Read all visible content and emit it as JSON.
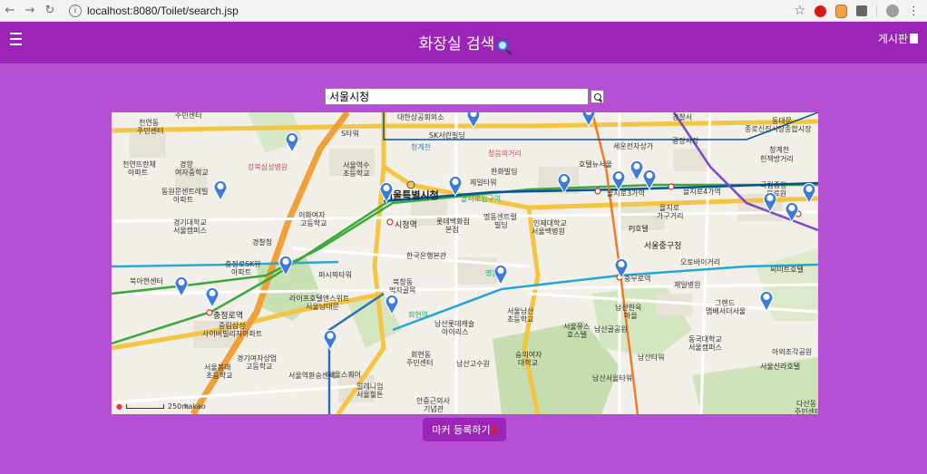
{
  "browser": {
    "url": "localhost:8080/Toilet/search.jsp"
  },
  "header": {
    "title": "화장실 검색",
    "board_link": "게시판"
  },
  "search": {
    "value": "서울시청"
  },
  "map": {
    "scale_label": "250m",
    "provider": "kakao",
    "labels": [
      {
        "text": "천연동",
        "cls": ""
      },
      {
        "text": "주민센터",
        "cls": ""
      },
      {
        "text": "주민센터",
        "cls": ""
      },
      {
        "text": "천연뜨란채",
        "cls": ""
      },
      {
        "text": "아파트",
        "cls": ""
      },
      {
        "text": "경향",
        "cls": ""
      },
      {
        "text": "여자중학교",
        "cls": ""
      },
      {
        "text": "강북삼성병원",
        "cls": ""
      },
      {
        "text": "동원문센트레빌",
        "cls": ""
      },
      {
        "text": "아파트",
        "cls": ""
      },
      {
        "text": "S타워",
        "cls": ""
      },
      {
        "text": "서울역수",
        "cls": ""
      },
      {
        "text": "초등학교",
        "cls": ""
      },
      {
        "text": "이화여자",
        "cls": ""
      },
      {
        "text": "고등학교",
        "cls": ""
      },
      {
        "text": "경기대학교",
        "cls": ""
      },
      {
        "text": "서울캠퍼스",
        "cls": ""
      },
      {
        "text": "경찰청",
        "cls": ""
      },
      {
        "text": "충정로SK뷰",
        "cls": ""
      },
      {
        "text": "아파트",
        "cls": ""
      },
      {
        "text": "북아현센터",
        "cls": ""
      },
      {
        "text": "충정로역",
        "cls": "mid"
      },
      {
        "text": "중림삼성",
        "cls": ""
      },
      {
        "text": "사이버빌리지아파트",
        "cls": ""
      },
      {
        "text": "경기여자상업",
        "cls": ""
      },
      {
        "text": "고등학교",
        "cls": ""
      },
      {
        "text": "서울봉래",
        "cls": ""
      },
      {
        "text": "초등학교",
        "cls": ""
      },
      {
        "text": "퍼시픽타워",
        "cls": ""
      },
      {
        "text": "라이프호텔앤스위트",
        "cls": ""
      },
      {
        "text": "서울남대문",
        "cls": ""
      },
      {
        "text": "서울역환승센터",
        "cls": ""
      },
      {
        "text": "서울스퀘어",
        "cls": ""
      },
      {
        "text": "밀레니엄",
        "cls": ""
      },
      {
        "text": "서울힐튼",
        "cls": ""
      },
      {
        "text": "SK서린빌딩",
        "cls": ""
      },
      {
        "text": "청계천",
        "cls": ""
      },
      {
        "text": "청음의거리",
        "cls": ""
      },
      {
        "text": "제일타워",
        "cls": ""
      },
      {
        "text": "한화빌딩",
        "cls": ""
      },
      {
        "text": "서울특별시청",
        "cls": "big"
      },
      {
        "text": "을지로입구역",
        "cls": ""
      },
      {
        "text": "시청역",
        "cls": "mid"
      },
      {
        "text": "롯데백화점",
        "cls": ""
      },
      {
        "text": "본점",
        "cls": ""
      },
      {
        "text": "명동센트럴",
        "cls": ""
      },
      {
        "text": "빌딩",
        "cls": ""
      },
      {
        "text": "인제대학교",
        "cls": ""
      },
      {
        "text": "서울백병원",
        "cls": ""
      },
      {
        "text": "한국은행본관",
        "cls": ""
      },
      {
        "text": "북창동",
        "cls": ""
      },
      {
        "text": "먹자골목",
        "cls": ""
      },
      {
        "text": "회현역",
        "cls": ""
      },
      {
        "text": "남산롯데캐슬",
        "cls": ""
      },
      {
        "text": "아이리스",
        "cls": ""
      },
      {
        "text": "회현동",
        "cls": ""
      },
      {
        "text": "주민센터",
        "cls": ""
      },
      {
        "text": "남산고수원",
        "cls": ""
      },
      {
        "text": "명동역",
        "cls": ""
      },
      {
        "text": "서울남산",
        "cls": ""
      },
      {
        "text": "초등학교",
        "cls": ""
      },
      {
        "text": "숭의여자",
        "cls": ""
      },
      {
        "text": "대학교",
        "cls": ""
      },
      {
        "text": "안중근의사",
        "cls": ""
      },
      {
        "text": "기념관",
        "cls": ""
      },
      {
        "text": "세운전자상가",
        "cls": ""
      },
      {
        "text": "호텔뉴서울",
        "cls": ""
      },
      {
        "text": "을지로3가역",
        "cls": ""
      },
      {
        "text": "PJ호텔",
        "cls": ""
      },
      {
        "text": "서울중구청",
        "cls": "mid"
      },
      {
        "text": "충무로역",
        "cls": ""
      },
      {
        "text": "서울유스",
        "cls": ""
      },
      {
        "text": "호스텔",
        "cls": ""
      },
      {
        "text": "남산골공원",
        "cls": ""
      },
      {
        "text": "남산한옥",
        "cls": ""
      },
      {
        "text": "마을",
        "cls": ""
      },
      {
        "text": "오토바이거리",
        "cls": ""
      },
      {
        "text": "제일병원",
        "cls": ""
      },
      {
        "text": "동국대학교",
        "cls": ""
      },
      {
        "text": "서울캠퍼스",
        "cls": ""
      },
      {
        "text": "남산서울타워",
        "cls": ""
      },
      {
        "text": "광장시장",
        "cls": ""
      },
      {
        "text": "청계천",
        "cls": ""
      },
      {
        "text": "헌책방거리",
        "cls": ""
      },
      {
        "text": "국립중앙",
        "cls": ""
      },
      {
        "text": "의료원",
        "cls": ""
      },
      {
        "text": "을지로4가역",
        "cls": ""
      },
      {
        "text": "을지로",
        "cls": ""
      },
      {
        "text": "가구거리",
        "cls": ""
      },
      {
        "text": "그랜드",
        "cls": ""
      },
      {
        "text": "앰배서더서울",
        "cls": ""
      },
      {
        "text": "씨미트호텔",
        "cls": ""
      },
      {
        "text": "아외조각공원",
        "cls": ""
      },
      {
        "text": "서울신라호텔",
        "cls": ""
      },
      {
        "text": "다산동",
        "cls": ""
      },
      {
        "text": "주민센터",
        "cls": ""
      },
      {
        "text": "경찰서",
        "cls": ""
      },
      {
        "text": "동대문",
        "cls": ""
      },
      {
        "text": "종로신진시장",
        "cls": ""
      },
      {
        "text": "종합시장",
        "cls": ""
      },
      {
        "text": "대한상공회의소",
        "cls": ""
      },
      {
        "text": "남산타워",
        "cls": ""
      }
    ]
  },
  "register_button": {
    "label": "마커 등록하기"
  }
}
